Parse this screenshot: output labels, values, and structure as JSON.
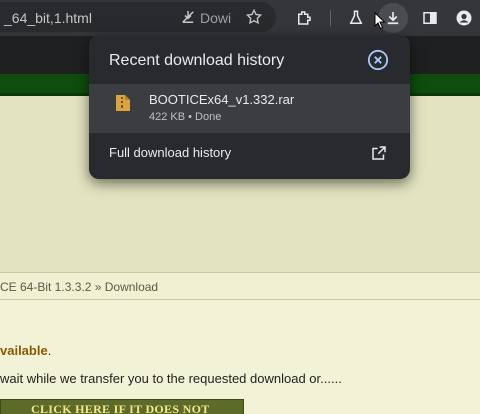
{
  "browser": {
    "url_fragment": "_64_bit,1.html",
    "url_status": "Dowi",
    "icons": [
      "download-blocked-icon",
      "star-icon",
      "extensions-icon",
      "labs-icon",
      "download-icon",
      "side-panel-icon",
      "profile-icon"
    ]
  },
  "download_popup": {
    "title": "Recent download history",
    "items": [
      {
        "file_name": "BOOTICEx64_v1.332.rar",
        "meta": "422 KB • Done",
        "icon": "archive-file-icon"
      }
    ],
    "full_history_label": "Full download history"
  },
  "page": {
    "breadcrumb": "CE 64-Bit 1.3.3.2 » Download",
    "available_bold": "vailable",
    "available_rest": ".",
    "wait_text": "wait while we transfer you to the requested download or......",
    "click_button": "CLICK HERE IF IT DOES NOT"
  },
  "colors": {
    "toolbar": "#35363a",
    "popup_bg": "#292a2d",
    "popup_item": "#3c3d41",
    "accent_close": "#a8c7fa",
    "page_green": "#0e4d0e",
    "page_bg": "#f2f2d6"
  }
}
